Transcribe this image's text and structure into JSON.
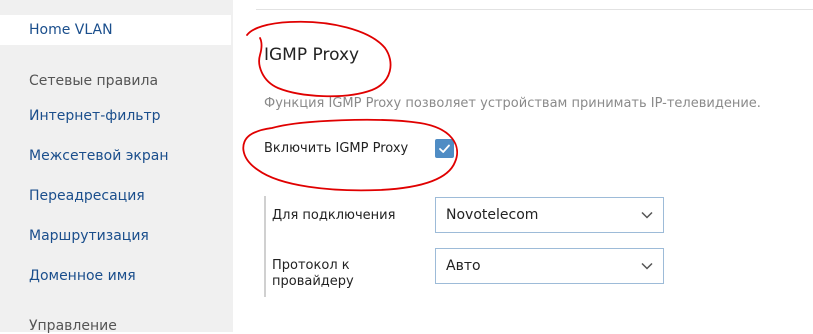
{
  "sidebar": {
    "active_item": "Home VLAN",
    "section_network": "Сетевые правила",
    "items": [
      {
        "label": "Интернет-фильтр"
      },
      {
        "label": "Межсетевой экран"
      },
      {
        "label": "Переадресация"
      },
      {
        "label": "Маршрутизация"
      },
      {
        "label": "Доменное имя"
      }
    ],
    "section_manage": "Управление"
  },
  "igmp": {
    "title": "IGMP Proxy",
    "description": "Функция IGMP Proxy позволяет устройствам принимать IP-телевидение.",
    "enable_label": "Включить IGMP Proxy",
    "enabled": true,
    "connection_label": "Для подключения",
    "connection_value": "Novotelecom",
    "protocol_label": "Протокол к провайдеру",
    "protocol_value": "Авто"
  },
  "colors": {
    "accent": "#4f8cc4",
    "link": "#1a4e8c",
    "annotation": "#e00000"
  }
}
